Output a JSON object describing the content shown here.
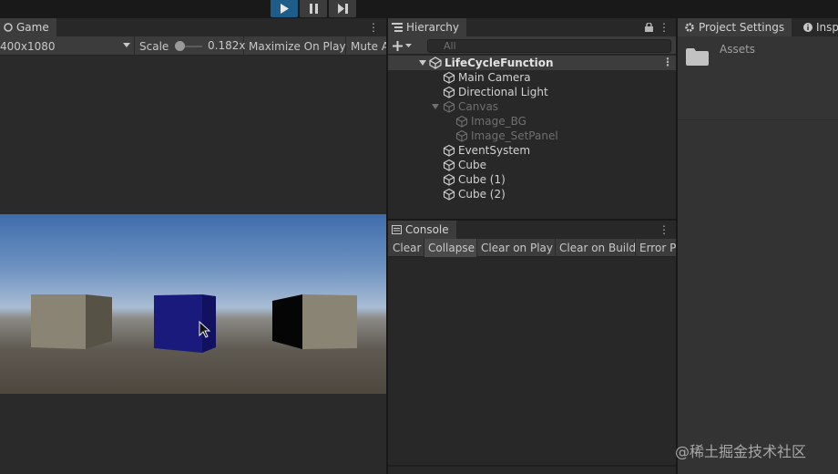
{
  "toolbar": {
    "play_icon": "play-icon",
    "pause_icon": "pause-icon",
    "step_icon": "step-icon",
    "accent": "#1e5d8a"
  },
  "game": {
    "tab_label": "Game",
    "resolution": "400x1080",
    "scale_label": "Scale",
    "scale_value": "0.182x",
    "maximize_label": "Maximize On Play",
    "mute_label": "Mute A",
    "cube_colors": [
      "#8a8474",
      "#1a1a7c",
      "#8a8474"
    ]
  },
  "hierarchy": {
    "tab_label": "Hierarchy",
    "search_placeholder": "All",
    "scene": "LifeCycleFunction",
    "items": [
      {
        "label": "Main Camera"
      },
      {
        "label": "Directional Light"
      },
      {
        "label": "Canvas"
      },
      {
        "label": "Image_BG"
      },
      {
        "label": "Image_SetPanel"
      },
      {
        "label": "EventSystem"
      },
      {
        "label": "Cube"
      },
      {
        "label": "Cube (1)"
      },
      {
        "label": "Cube (2)"
      }
    ]
  },
  "console": {
    "tab_label": "Console",
    "buttons": [
      "Clear",
      "Collapse",
      "Clear on Play",
      "Clear on Build",
      "Error Pa"
    ]
  },
  "project": {
    "tab_label": "Project Settings",
    "inspector_tab": "Insp",
    "assets_label": "Assets"
  },
  "watermark": "@稀土掘金技术社区"
}
